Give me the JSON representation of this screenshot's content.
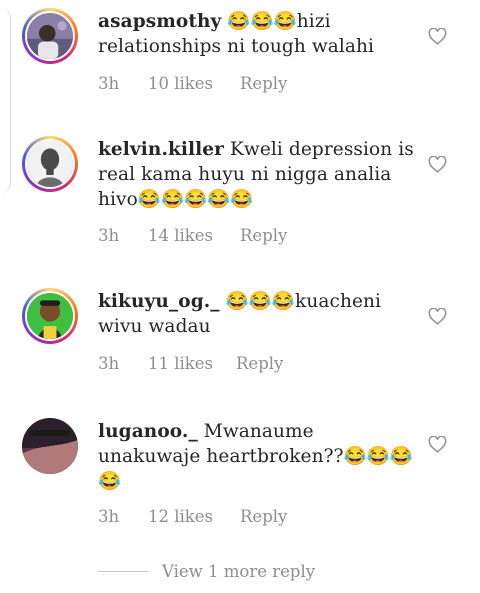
{
  "comments": [
    {
      "username": "asapsmothy",
      "text": " 😂😂😂hizi relationships ni tough walahi",
      "time": "3h",
      "likes": "10 likes",
      "reply": "Reply",
      "avatar": "ring-avatar-person"
    },
    {
      "username": "kelvin.killer",
      "text": " Kweli depression is real kama huyu ni nigga analia hivo😂😂😂😂😂",
      "time": "3h",
      "likes": "14 likes",
      "reply": "Reply",
      "avatar": "ring-avatar-person"
    },
    {
      "username": "kikuyu_og._",
      "text": "  😂😂😂kuacheni wivu wadau",
      "time": "3h",
      "likes": "11 likes",
      "reply": "Reply",
      "avatar": "ring-avatar-cartoon"
    },
    {
      "username": "luganoo._",
      "text": " Mwanaume unakuwaje heartbroken??😂😂😂😂",
      "time": "3h",
      "likes": "12 likes",
      "reply": "Reply",
      "avatar": "plain-avatar-photo"
    }
  ],
  "view_more": "View 1 more reply",
  "colors": {
    "muted": "#8e8e8e",
    "text": "#262626",
    "divider": "#dbdbdb"
  },
  "icons": {
    "like": "heart-outline-icon"
  }
}
